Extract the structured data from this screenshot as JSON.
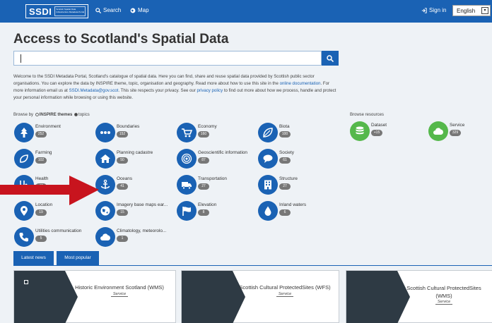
{
  "header": {
    "logo_text": "SSDI",
    "logo_subtext": "Scottish Spatial Data Infrastructure Metadata Portal",
    "nav_search": "Search",
    "nav_map": "Map",
    "sign_in": "Sign in",
    "language": "English"
  },
  "page_title": "Access to Scotland's Spatial Data",
  "search": {
    "value": ""
  },
  "welcome": {
    "part1": "Welcome to the SSDI Metadata Portal, Scotland's catalogue of spatial data. Here you can find, share and reuse spatial data provided by Scottish public sector organisations. You can explore the data by INSPIRE theme, topic, organisation and geography. Read more about how to use this site in the ",
    "link1": "online documentation",
    "part2": ". For more information email us at ",
    "link2": "SSDI.Metadata@gov.scot",
    "part3": ". This site respects your privacy. See our ",
    "link3": "privacy policy",
    "part4": " to find out more about how we process, handle and protect your personal information while browsing or using this website."
  },
  "browse": {
    "prefix": "Browse by",
    "option_inspire": "INSPIRE themes",
    "option_topics": "topics",
    "resources_label": "Browse resources"
  },
  "categories": [
    {
      "label": "Environment",
      "count": "252",
      "icon": "tree-icon"
    },
    {
      "label": "Boundaries",
      "count": "152",
      "icon": "dots-icon"
    },
    {
      "label": "Economy",
      "count": "160",
      "icon": "cart-icon"
    },
    {
      "label": "Biota",
      "count": "100",
      "icon": "leaf-icon"
    },
    {
      "label": "Farming",
      "count": "102",
      "icon": "farming-icon"
    },
    {
      "label": "Planning cadastre",
      "count": "50",
      "icon": "house-icon"
    },
    {
      "label": "Geoscientific information",
      "count": "87",
      "icon": "target-icon"
    },
    {
      "label": "Society",
      "count": "61",
      "icon": "speech-icon"
    },
    {
      "label": "Health",
      "count": "47",
      "icon": "stethoscope-icon"
    },
    {
      "label": "Oceans",
      "count": "41",
      "icon": "anchor-icon"
    },
    {
      "label": "Transportation",
      "count": "27",
      "icon": "truck-icon"
    },
    {
      "label": "Structure",
      "count": "27",
      "icon": "building-icon"
    },
    {
      "label": "Location",
      "count": "19",
      "icon": "location-pin-icon"
    },
    {
      "label": "Imagery base maps ear...",
      "count": "15",
      "icon": "globe-icon"
    },
    {
      "label": "Elevation",
      "count": "8",
      "icon": "flag-icon"
    },
    {
      "label": "Inland waters",
      "count": "6",
      "icon": "water-drop-icon"
    },
    {
      "label": "Utilities communication",
      "count": "5",
      "icon": "phone-icon"
    },
    {
      "label": "Climatology, meteorolo...",
      "count": "1",
      "icon": "cloud-icon"
    }
  ],
  "resources": [
    {
      "label": "Dataset",
      "count": "+15",
      "icon": "database-icon"
    },
    {
      "label": "Service",
      "count": "329",
      "icon": "cloud-icon"
    }
  ],
  "tabs": {
    "latest": "Latest news",
    "popular": "Most popular"
  },
  "cards": [
    {
      "title": "Historic Environment Scotland (WMS)",
      "type": "Service"
    },
    {
      "title": "Scottish Cultural ProtectedSites (WFS)",
      "type": "Service"
    },
    {
      "title": "Scottish Cultural ProtectedSites (WMS)",
      "type": "Service"
    }
  ],
  "colors": {
    "brand_blue": "#1a62b4",
    "resource_green": "#55b84b",
    "arrow_red": "#c8141e",
    "badge_gray": "#777777"
  }
}
